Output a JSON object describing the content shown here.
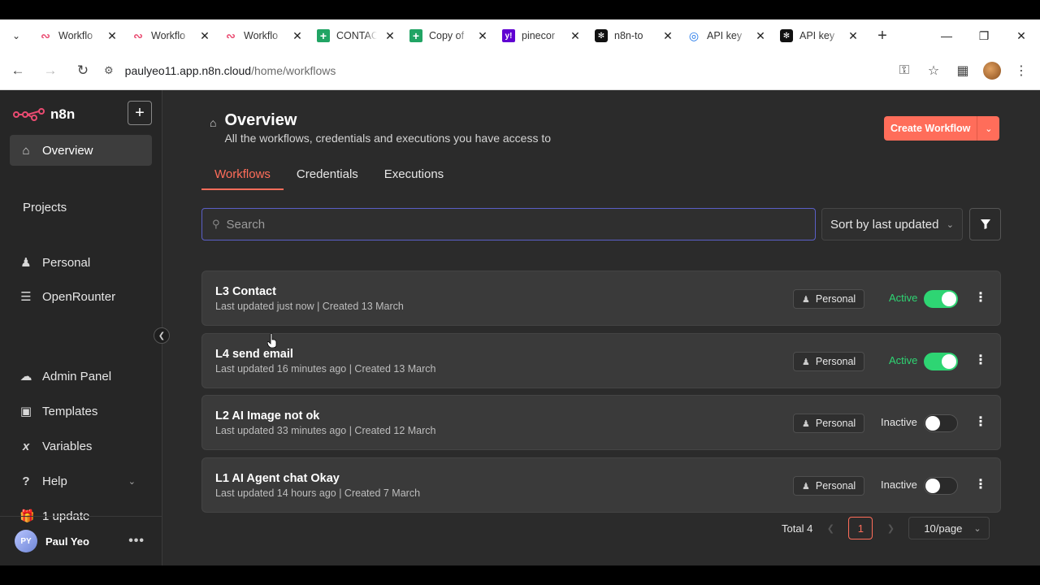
{
  "browser": {
    "tabs": [
      {
        "title": "Workflo",
        "favicon": "n8n-icon",
        "color": "#ea4b71"
      },
      {
        "title": "Workflo",
        "favicon": "n8n-icon",
        "color": "#ea4b71"
      },
      {
        "title": "Workflo",
        "favicon": "n8n-icon",
        "color": "#ea4b71",
        "active": true
      },
      {
        "title": "CONTAC",
        "favicon": "sheets-icon",
        "color": "#21a464"
      },
      {
        "title": "Copy of",
        "favicon": "sheets-icon",
        "color": "#21a464"
      },
      {
        "title": "pinecor",
        "favicon": "yahoo-icon",
        "color": "#6001d2"
      },
      {
        "title": "n8n-to",
        "favicon": "openai-icon",
        "color": "#111111"
      },
      {
        "title": "API key",
        "favicon": "ai-studio-icon",
        "color": "#1a73e8"
      },
      {
        "title": "API key",
        "favicon": "openai-icon",
        "color": "#111111"
      }
    ],
    "url_host": "paulyeo11.app.n8n.cloud",
    "url_path": "/home/workflows"
  },
  "sidebar": {
    "brand": "n8n",
    "nav_overview": "Overview",
    "projects_heading": "Projects",
    "project_personal": "Personal",
    "project_openrounter": "OpenRounter",
    "admin_panel": "Admin Panel",
    "templates": "Templates",
    "variables": "Variables",
    "help": "Help",
    "update": "1 update",
    "user_initials": "PY",
    "user_name": "Paul Yeo"
  },
  "header": {
    "title": "Overview",
    "subtitle": "All the workflows, credentials and executions you have access to",
    "create_label": "Create Workflow"
  },
  "tabs": [
    "Workflows",
    "Credentials",
    "Executions"
  ],
  "search": {
    "placeholder": "Search"
  },
  "sort": {
    "label": "Sort by last updated"
  },
  "workflows": [
    {
      "name": "L3 Contact",
      "meta": "Last updated just now | Created 13 March",
      "owner": "Personal",
      "status": "Active",
      "active": true
    },
    {
      "name": "L4 send email",
      "meta": "Last updated 16 minutes ago | Created 13 March",
      "owner": "Personal",
      "status": "Active",
      "active": true
    },
    {
      "name": "L2 AI Image not ok",
      "meta": "Last updated 33 minutes ago | Created 12 March",
      "owner": "Personal",
      "status": "Inactive",
      "active": false
    },
    {
      "name": "L1 AI Agent chat Okay",
      "meta": "Last updated 14 hours ago | Created 7 March",
      "owner": "Personal",
      "status": "Inactive",
      "active": false
    }
  ],
  "pagination": {
    "total": "Total 4",
    "current": "1",
    "per_page": "10/page"
  },
  "colors": {
    "accent": "#ff6d5a",
    "active_green": "#2ed573",
    "focus_border": "#5b5fc7"
  }
}
